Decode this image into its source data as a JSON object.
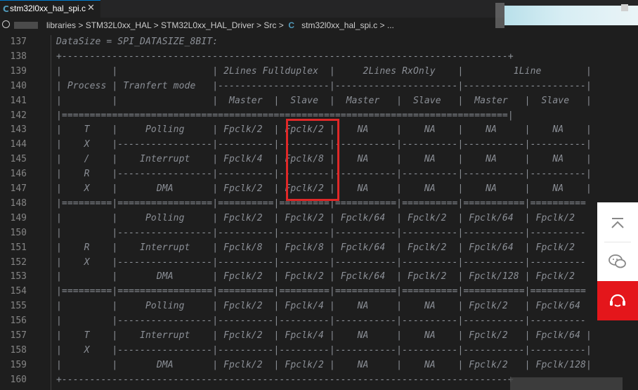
{
  "tab": {
    "icon": "C",
    "title": "stm32l0xx_hal_spi.c",
    "close": "✕"
  },
  "breadcrumb": {
    "items": [
      "libraries",
      "STM32L0xx_HAL",
      "STM32L0xx_HAL_Driver",
      "Src"
    ],
    "file_icon": "C",
    "file": "stm32l0xx_hal_spi.c",
    "tail": "..."
  },
  "code_lines": [
    {
      "n": "137",
      "t": "DataSize = SPI_DATASIZE_8BIT:"
    },
    {
      "n": "138",
      "t": "+--------------------------------------------------------------------------------+"
    },
    {
      "n": "139",
      "t": "|         |                 | 2Lines Fullduplex  |     2Lines RxOnly    |         1Line        |"
    },
    {
      "n": "140",
      "t": "| Process | Tranfert mode   |--------------------|----------------------|----------------------|"
    },
    {
      "n": "141",
      "t": "|         |                 |  Master  |  Slave  |  Master   |  Slave   |  Master   |  Slave   |"
    },
    {
      "n": "142",
      "t": "|================================================================================|"
    },
    {
      "n": "143",
      "t": "|    T    |     Polling     | Fpclk/2  | Fpclk/2 |    NA     |    NA    |    NA     |    NA    |"
    },
    {
      "n": "144",
      "t": "|    X    |-----------------|----------|---------|-----------|----------|-----------|----------|"
    },
    {
      "n": "145",
      "t": "|    /    |    Interrupt    | Fpclk/4  | Fpclk/8 |    NA     |    NA    |    NA     |    NA    |"
    },
    {
      "n": "146",
      "t": "|    R    |-----------------|----------|---------|-----------|----------|-----------|----------|"
    },
    {
      "n": "147",
      "t": "|    X    |       DMA       | Fpclk/2  | Fpclk/2 |    NA     |    NA    |    NA     |    NA    |"
    },
    {
      "n": "148",
      "t": "|=========|=================|==========|=========|===========|==========|===========|=========="
    },
    {
      "n": "149",
      "t": "|         |     Polling     | Fpclk/2  | Fpclk/2 | Fpclk/64  | Fpclk/2  | Fpclk/64  | Fpclk/2"
    },
    {
      "n": "150",
      "t": "|         |-----------------|----------|---------|-----------|----------|-----------|----------"
    },
    {
      "n": "151",
      "t": "|    R    |    Interrupt    | Fpclk/8  | Fpclk/8 | Fpclk/64  | Fpclk/2  | Fpclk/64  | Fpclk/2"
    },
    {
      "n": "152",
      "t": "|    X    |-----------------|----------|---------|-----------|----------|-----------|----------"
    },
    {
      "n": "153",
      "t": "|         |       DMA       | Fpclk/2  | Fpclk/2 | Fpclk/64  | Fpclk/2  | Fpclk/128 | Fpclk/2"
    },
    {
      "n": "154",
      "t": "|=========|=================|==========|=========|===========|==========|===========|=========="
    },
    {
      "n": "155",
      "t": "|         |     Polling     | Fpclk/2  | Fpclk/4 |    NA     |    NA    | Fpclk/2   | Fpclk/64"
    },
    {
      "n": "156",
      "t": "|         |-----------------|----------|---------|-----------|----------|-----------|----------"
    },
    {
      "n": "157",
      "t": "|    T    |    Interrupt    | Fpclk/2  | Fpclk/4 |    NA     |    NA    | Fpclk/2   | Fpclk/64 |"
    },
    {
      "n": "158",
      "t": "|    X    |-----------------|----------|---------|-----------|----------|-----------|----------|"
    },
    {
      "n": "159",
      "t": "|         |       DMA       | Fpclk/2  | Fpclk/2 |    NA     |    NA    | Fpclk/2   | Fpclk/128|"
    },
    {
      "n": "160",
      "t": "+--------------------------------------------------------------------------------+"
    }
  ],
  "colors": {
    "editor_bg": "#1e1e1e",
    "code_text": "#8b8f96",
    "line_number": "#858585",
    "highlight": "#e02828",
    "side_accent": "#e4161b"
  },
  "side_widget": {
    "icons": [
      "back-to-top-icon",
      "wechat-icon",
      "customer-service-icon"
    ]
  }
}
